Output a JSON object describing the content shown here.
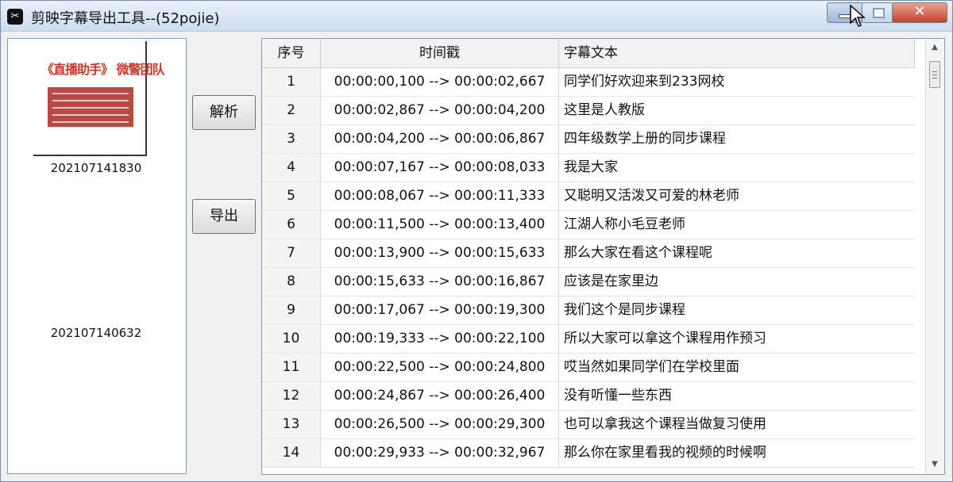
{
  "window": {
    "title": "剪映字幕导出工具--(52pojie)",
    "app_icon": "capcut-icon"
  },
  "file_list": [
    {
      "name": "202107141830",
      "thumbnail_header": "《直播助手》 微警团队"
    },
    {
      "name": "202107140632"
    }
  ],
  "buttons": {
    "parse": "解析",
    "export": "导出"
  },
  "table": {
    "columns": [
      "序号",
      "时间戳",
      "字幕文本"
    ],
    "rows": [
      {
        "index": "1",
        "timestamp": "00:00:00,100 --> 00:00:02,667",
        "text": "同学们好欢迎来到233网校"
      },
      {
        "index": "2",
        "timestamp": "00:00:02,867 --> 00:00:04,200",
        "text": "这里是人教版"
      },
      {
        "index": "3",
        "timestamp": "00:00:04,200 --> 00:00:06,867",
        "text": "四年级数学上册的同步课程"
      },
      {
        "index": "4",
        "timestamp": "00:00:07,167 --> 00:00:08,033",
        "text": "我是大家"
      },
      {
        "index": "5",
        "timestamp": "00:00:08,067 --> 00:00:11,333",
        "text": "又聪明又活泼又可爱的林老师"
      },
      {
        "index": "6",
        "timestamp": "00:00:11,500 --> 00:00:13,400",
        "text": "江湖人称小毛豆老师"
      },
      {
        "index": "7",
        "timestamp": "00:00:13,900 --> 00:00:15,633",
        "text": "那么大家在看这个课程呢"
      },
      {
        "index": "8",
        "timestamp": "00:00:15,633 --> 00:00:16,867",
        "text": "应该是在家里边"
      },
      {
        "index": "9",
        "timestamp": "00:00:17,067 --> 00:00:19,300",
        "text": "我们这个是同步课程"
      },
      {
        "index": "10",
        "timestamp": "00:00:19,333 --> 00:00:22,100",
        "text": "所以大家可以拿这个课程用作预习"
      },
      {
        "index": "11",
        "timestamp": "00:00:22,500 --> 00:00:24,800",
        "text": "哎当然如果同学们在学校里面"
      },
      {
        "index": "12",
        "timestamp": "00:00:24,867 --> 00:00:26,400",
        "text": "没有听懂一些东西"
      },
      {
        "index": "13",
        "timestamp": "00:00:26,500 --> 00:00:29,300",
        "text": "也可以拿我这个课程当做复习使用"
      },
      {
        "index": "14",
        "timestamp": "00:00:29,933 --> 00:00:32,967",
        "text": "那么你在家里看我的视频的时候啊"
      }
    ]
  },
  "icons": {
    "minimize": "minimize-icon",
    "maximize": "maximize-icon",
    "close": "close-icon",
    "cursor": "mouse-cursor-icon"
  }
}
